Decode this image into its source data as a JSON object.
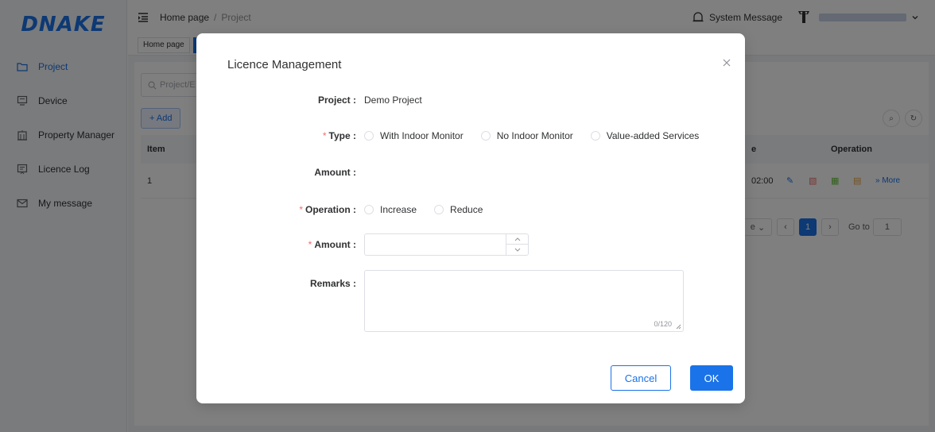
{
  "brand": {
    "logo_text": "DNAKE",
    "accent_color": "#1a73e8"
  },
  "header": {
    "breadcrumb_home": "Home page",
    "breadcrumb_sep": "/",
    "breadcrumb_current": "Project",
    "system_message": "System Message"
  },
  "sidebar": {
    "items": [
      {
        "label": "Project",
        "icon": "folder-icon"
      },
      {
        "label": "Device",
        "icon": "monitor-icon"
      },
      {
        "label": "Property Manager",
        "icon": "building-icon"
      },
      {
        "label": "Licence Log",
        "icon": "log-icon"
      },
      {
        "label": "My message",
        "icon": "mail-icon"
      }
    ]
  },
  "tabs": {
    "home": "Home page"
  },
  "main": {
    "search_placeholder": "Project/E",
    "add_button": "+ Add",
    "columns": {
      "item": "Item",
      "time_partial": "e",
      "operation": "Operation"
    },
    "row": {
      "item": "1",
      "time_partial": "02:00",
      "more": "» More"
    },
    "pager": {
      "size_partial": "e",
      "current_page": "1",
      "goto_label": "Go to",
      "goto_value": "1"
    }
  },
  "dialog": {
    "title": "Licence Management",
    "project_label": "Project :",
    "project_value": "Demo Project",
    "type_label": "Type :",
    "type_options": [
      "With Indoor Monitor",
      "No Indoor Monitor",
      "Value-added Services"
    ],
    "amount_label": "Amount :",
    "operation_label": "Operation :",
    "operation_options": [
      "Increase",
      "Reduce"
    ],
    "amount_input_label": "Amount :",
    "remarks_label": "Remarks :",
    "remarks_counter": "0/120",
    "cancel_label": "Cancel",
    "ok_label": "OK"
  }
}
